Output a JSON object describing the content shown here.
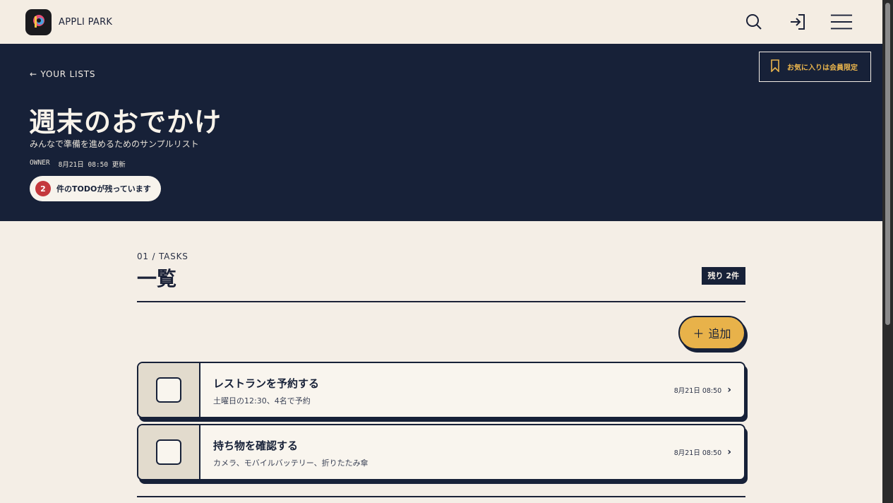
{
  "header": {
    "brand": "APPLI PARK",
    "icons": {
      "logo": "logo-icon",
      "search": "search-icon",
      "login": "login-icon",
      "menu": "menu-icon"
    }
  },
  "hero": {
    "back_link": "← YOUR LISTS",
    "favorite_label": "お気に入りは会員限定",
    "title": "週末のおでかけ",
    "subtitle": "みんなで準備を進めるためのサンプルリスト",
    "owner_label": "OWNER",
    "updated": "8月21日 08:50 更新",
    "todo_count": "2",
    "todo_text": "件のTODOが残っています"
  },
  "section": {
    "label": "01 / TASKS",
    "title": "一覧",
    "remaining_badge": "残り 2件",
    "add_label": "追加"
  },
  "tasks": [
    {
      "title": "レストランを予約する",
      "desc": "土曜日の12:30、4名で予約",
      "date": "8月21日 08:50"
    },
    {
      "title": "持ち物を確認する",
      "desc": "カメラ、モバイルバッテリー、折りたたみ傘",
      "date": "8月21日 08:50"
    }
  ],
  "colors": {
    "navy": "#172138",
    "cream": "#f4eee6",
    "accent": "#e8b24a",
    "alert": "#c4383d"
  }
}
